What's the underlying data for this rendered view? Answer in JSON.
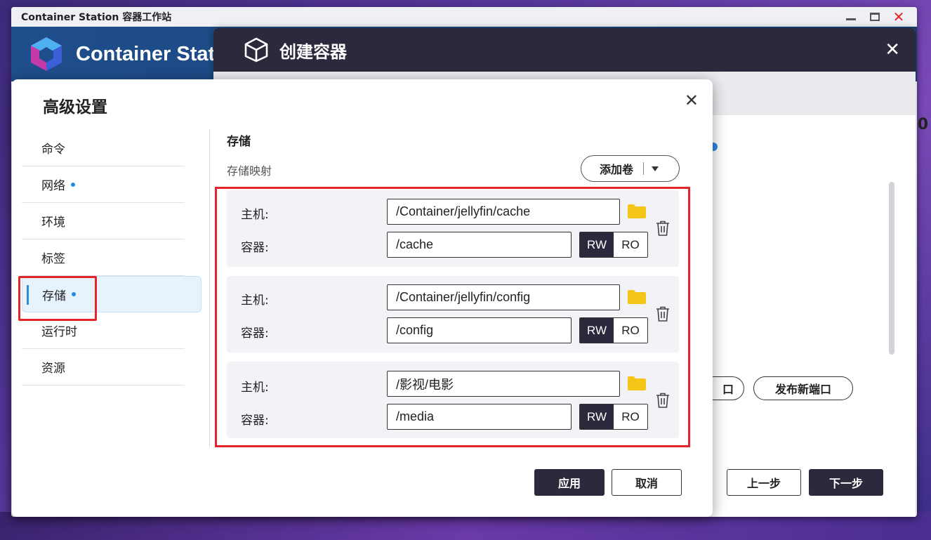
{
  "app": {
    "window_title": "Container Station 容器工作站",
    "header_title": "Container Station",
    "edge_text": "0"
  },
  "create_dialog": {
    "title": "创建容器",
    "port_button_partial": "口",
    "publish_port_label": "发布新端口",
    "prev_label": "上一步",
    "next_label": "下一步"
  },
  "advanced": {
    "title": "高级设置",
    "nav": [
      {
        "label": "命令",
        "dot": false
      },
      {
        "label": "网络",
        "dot": true
      },
      {
        "label": "环境",
        "dot": false
      },
      {
        "label": "标签",
        "dot": false
      },
      {
        "label": "存储",
        "dot": true,
        "active": true
      },
      {
        "label": "运行时",
        "dot": false
      },
      {
        "label": "资源",
        "dot": false
      }
    ],
    "section_title": "存储",
    "section_sub": "存储映射",
    "add_volume_label": "添加卷",
    "host_label": "主机:",
    "container_label": "容器:",
    "volumes": [
      {
        "host": "/Container/jellyfin/cache",
        "container": "/cache",
        "mode": "RW"
      },
      {
        "host": "/Container/jellyfin/config",
        "container": "/config",
        "mode": "RW"
      },
      {
        "host": "/影视/电影",
        "container": "/media",
        "mode": "RW"
      }
    ],
    "rw_label": "RW",
    "ro_label": "RO",
    "apply_label": "应用",
    "cancel_label": "取消"
  },
  "colors": {
    "accent": "#2b8be0",
    "dark_button": "#2a2a3c",
    "highlight": "#e3242b",
    "folder": "#f5c518"
  }
}
